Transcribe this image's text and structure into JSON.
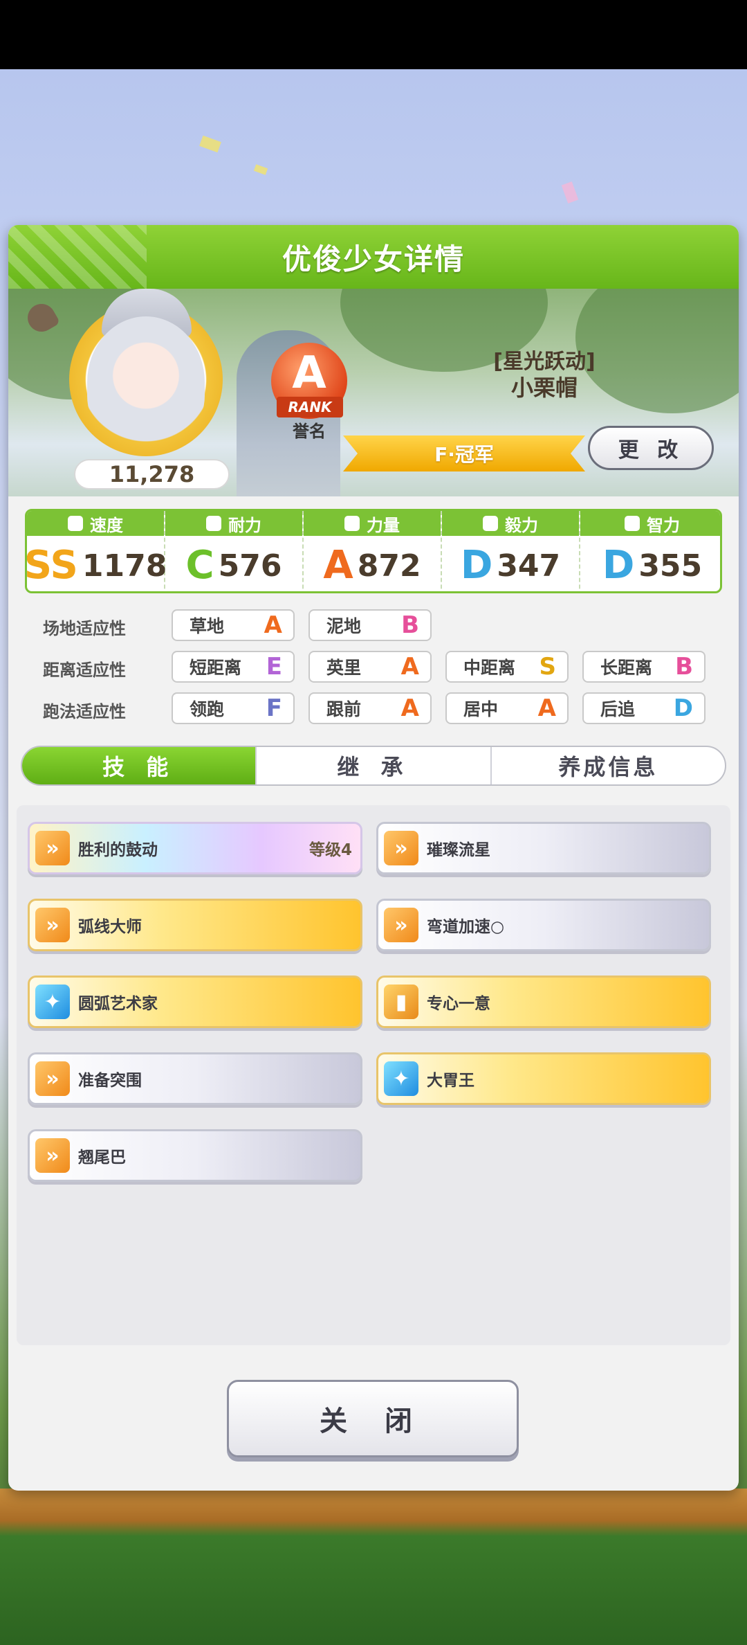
{
  "dialog": {
    "title": "优俊少女详情"
  },
  "profile": {
    "score": "11,278",
    "rank_letter": "A",
    "rank_ribbon": "RANK",
    "rank_caption": "誉名",
    "epithet": "[星光跃动]",
    "name": "小栗帽",
    "title_banner": "F·冠军",
    "change_label": "更 改"
  },
  "stats": [
    {
      "label": "速度",
      "icon": "shoe-icon",
      "grade": "SS+",
      "grade_display": "SS",
      "value": "1178",
      "color": "#f2a51a"
    },
    {
      "label": "耐力",
      "icon": "heart-icon",
      "grade": "C+",
      "grade_display": "C",
      "value": "576",
      "color": "#6cc02a"
    },
    {
      "label": "力量",
      "icon": "muscle-icon",
      "grade": "A",
      "grade_display": "A",
      "value": "872",
      "color": "#ef6a1e"
    },
    {
      "label": "毅力",
      "icon": "flame-icon",
      "grade": "D",
      "grade_display": "D",
      "value": "347",
      "color": "#3aa6e0"
    },
    {
      "label": "智力",
      "icon": "graduation-cap-icon",
      "grade": "D+",
      "grade_display": "D",
      "value": "355",
      "color": "#3aa6e0"
    }
  ],
  "aptitudes": [
    {
      "label": "场地适应性",
      "items": [
        {
          "name": "草地",
          "grade": "A",
          "color": "#ef6a1e"
        },
        {
          "name": "泥地",
          "grade": "B",
          "color": "#e64f9a"
        }
      ]
    },
    {
      "label": "距离适应性",
      "items": [
        {
          "name": "短距离",
          "grade": "E",
          "color": "#b264d6"
        },
        {
          "name": "英里",
          "grade": "A",
          "color": "#ef6a1e"
        },
        {
          "name": "中距离",
          "grade": "S",
          "color": "#e2a611"
        },
        {
          "name": "长距离",
          "grade": "B",
          "color": "#e64f9a"
        }
      ]
    },
    {
      "label": "跑法适应性",
      "items": [
        {
          "name": "领跑",
          "grade": "F",
          "color": "#6b74c6"
        },
        {
          "name": "跟前",
          "grade": "A",
          "color": "#ef6a1e"
        },
        {
          "name": "居中",
          "grade": "A",
          "color": "#ef6a1e"
        },
        {
          "name": "后追",
          "grade": "D",
          "color": "#3aa6e0"
        }
      ]
    }
  ],
  "tabs": [
    {
      "label": "技 能",
      "active": true
    },
    {
      "label": "继 承",
      "active": false
    },
    {
      "label": "养成信息",
      "active": false
    }
  ],
  "skills": [
    {
      "name": "胜利的鼓动",
      "level": "等级4",
      "style": "rainbow",
      "icon": "running-horse-icon"
    },
    {
      "name": "璀璨流星",
      "level": "",
      "style": "plain",
      "icon": "running-horse-icon"
    },
    {
      "name": "弧线大师",
      "level": "",
      "style": "gold",
      "icon": "running-horse-icon"
    },
    {
      "name": "弯道加速○",
      "level": "",
      "style": "plain",
      "icon": "running-horse-icon"
    },
    {
      "name": "圆弧艺术家",
      "level": "",
      "style": "gold",
      "icon": "sparkle-icon"
    },
    {
      "name": "专心一意",
      "level": "",
      "style": "gold",
      "icon": "recovery-icon"
    },
    {
      "name": "准备突围",
      "level": "",
      "style": "plain",
      "icon": "running-horse-icon"
    },
    {
      "name": "大胃王",
      "level": "",
      "style": "gold",
      "icon": "sparkle-icon"
    },
    {
      "name": "翘尾巴",
      "level": "",
      "style": "plain",
      "icon": "running-horse-icon"
    }
  ],
  "close_label": "关 闭"
}
